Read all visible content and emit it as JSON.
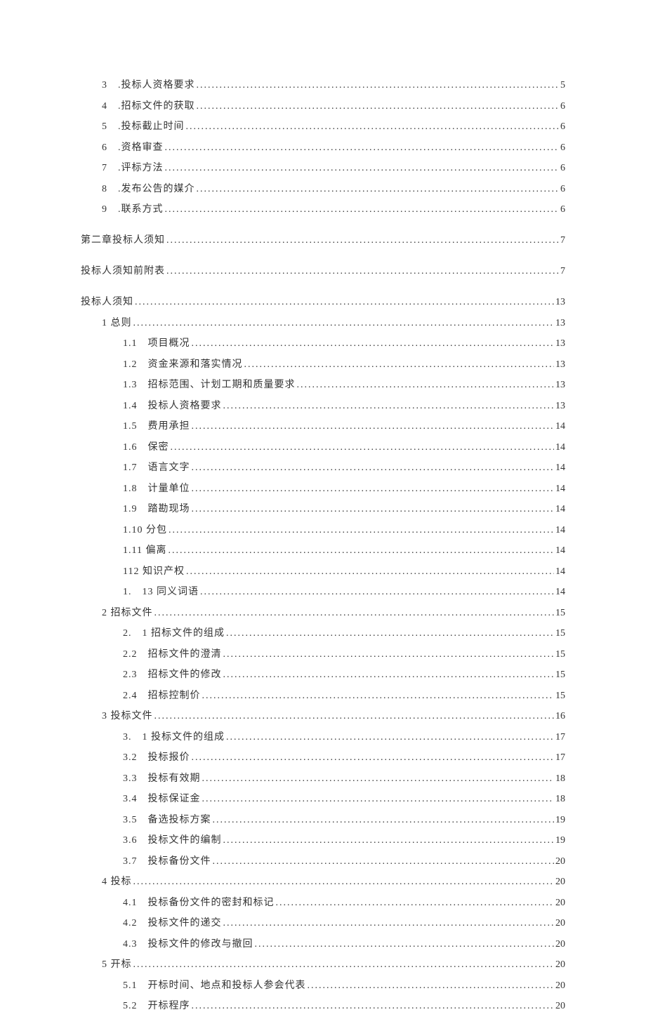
{
  "toc": [
    {
      "indent": 1,
      "label": "3　.投标人资格要求",
      "page": "5",
      "gap": false
    },
    {
      "indent": 1,
      "label": "4　.招标文件的获取",
      "page": "6",
      "gap": false
    },
    {
      "indent": 1,
      "label": "5　.投标截止时间",
      "page": "6",
      "gap": false
    },
    {
      "indent": 1,
      "label": "6　.资格审查",
      "page": "6",
      "gap": false
    },
    {
      "indent": 1,
      "label": "7　.评标方法",
      "page": "6",
      "gap": false
    },
    {
      "indent": 1,
      "label": "8　.发布公告的媒介",
      "page": "6",
      "gap": false
    },
    {
      "indent": 1,
      "label": "9　.联系方式",
      "page": "6",
      "gap": false
    },
    {
      "indent": 0,
      "label": "第二章投标人须知",
      "page": "7",
      "gap": true
    },
    {
      "indent": 0,
      "label": "投标人须知前附表",
      "page": "7",
      "gap": true
    },
    {
      "indent": 0,
      "label": "投标人须知",
      "page": "13",
      "gap": true
    },
    {
      "indent": 1,
      "label": "1 总则",
      "page": "13",
      "gap": false
    },
    {
      "indent": 2,
      "label": "1.1　项目概况",
      "page": "13",
      "gap": false
    },
    {
      "indent": 2,
      "label": "1.2　资金来源和落实情况",
      "page": "13",
      "gap": false
    },
    {
      "indent": 2,
      "label": "1.3　招标范围、计划工期和质量要求",
      "page": "13",
      "gap": false
    },
    {
      "indent": 2,
      "label": "1.4　投标人资格要求",
      "page": "13",
      "gap": false
    },
    {
      "indent": 2,
      "label": "1.5　费用承担",
      "page": "14",
      "gap": false
    },
    {
      "indent": 2,
      "label": "1.6　保密",
      "page": "14",
      "gap": false
    },
    {
      "indent": 2,
      "label": "1.7　语言文字",
      "page": "14",
      "gap": false
    },
    {
      "indent": 2,
      "label": "1.8　计量单位",
      "page": "14",
      "gap": false
    },
    {
      "indent": 2,
      "label": "1.9　踏勘现场",
      "page": "14",
      "gap": false
    },
    {
      "indent": 2,
      "label": "1.10 分包",
      "page": "14",
      "gap": false
    },
    {
      "indent": 2,
      "label": "1.11 偏离",
      "page": "14",
      "gap": false
    },
    {
      "indent": 2,
      "label": "112 知识产权",
      "page": "14",
      "gap": false
    },
    {
      "indent": 2,
      "label": "1.　13 同义词语",
      "page": "14",
      "gap": false
    },
    {
      "indent": 1,
      "label": "2 招标文件",
      "page": "15",
      "gap": false
    },
    {
      "indent": 2,
      "label": "2.　1 招标文件的组成 ",
      "page": "15",
      "gap": false
    },
    {
      "indent": 2,
      "label": "2.2　招标文件的澄清 ",
      "page": "15",
      "gap": false
    },
    {
      "indent": 2,
      "label": "2.3　招标文件的修改 ",
      "page": "15",
      "gap": false
    },
    {
      "indent": 2,
      "label": "2.4　招标控制价 ",
      "page": "15",
      "gap": false
    },
    {
      "indent": 1,
      "label": "3 投标文件",
      "page": "16",
      "gap": false
    },
    {
      "indent": 2,
      "label": "3.　1 投标文件的组成 ",
      "page": "17",
      "gap": false
    },
    {
      "indent": 2,
      "label": "3.2　投标报价 ",
      "page": "17",
      "gap": false
    },
    {
      "indent": 2,
      "label": "3.3　投标有效期 ",
      "page": "18",
      "gap": false
    },
    {
      "indent": 2,
      "label": "3.4　投标保证金 ",
      "page": "18",
      "gap": false
    },
    {
      "indent": 2,
      "label": "3.5　备选投标方案 ",
      "page": "19",
      "gap": false
    },
    {
      "indent": 2,
      "label": "3.6　投标文件的编制 ",
      "page": "19",
      "gap": false
    },
    {
      "indent": 2,
      "label": "3.7　投标备份文件 ",
      "page": "20",
      "gap": false
    },
    {
      "indent": 1,
      "label": "4 投标",
      "page": "20",
      "gap": false
    },
    {
      "indent": 2,
      "label": "4.1　投标备份文件的密封和标记 ",
      "page": "20",
      "gap": false
    },
    {
      "indent": 2,
      "label": "4.2　投标文件的递交 ",
      "page": "20",
      "gap": false
    },
    {
      "indent": 2,
      "label": "4.3　投标文件的修改与撤回 ",
      "page": "20",
      "gap": false
    },
    {
      "indent": 1,
      "label": "5 开标",
      "page": "20",
      "gap": false
    },
    {
      "indent": 2,
      "label": "5.1　开标时间、地点和投标人参会代表",
      "page": "20",
      "gap": false
    },
    {
      "indent": 2,
      "label": "5.2　开标程序",
      "page": "20",
      "gap": false
    }
  ]
}
